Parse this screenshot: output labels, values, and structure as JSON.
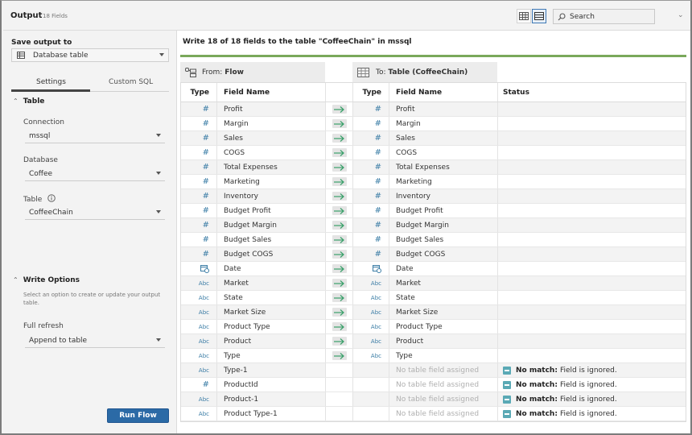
{
  "header": {
    "title": "Output",
    "field_count": "18 Fields",
    "search_placeholder": "Search",
    "view_buttons": [
      {
        "name": "grid-view",
        "active": false
      },
      {
        "name": "list-view",
        "active": true
      }
    ]
  },
  "left_panel": {
    "save_output_label": "Save output to",
    "save_output_value": "Database table",
    "tabs": [
      {
        "label": "Settings",
        "active": true
      },
      {
        "label": "Custom SQL",
        "active": false
      }
    ],
    "table_section": {
      "title": "Table",
      "connection_label": "Connection",
      "connection_value": "mssql",
      "database_label": "Database",
      "database_value": "Coffee",
      "table_label": "Table",
      "table_value": "CoffeeChain"
    },
    "write_options": {
      "title": "Write Options",
      "help": "Select an option to create or update your output table.",
      "mode_label": "Full refresh",
      "mode_value": "Append to table"
    },
    "run_button": "Run Flow"
  },
  "main": {
    "message": "Write 18 of 18 fields to the table \"CoffeeChain\" in mssql",
    "from_prefix": "From:",
    "from_name": "Flow",
    "to_prefix": "To:",
    "to_name": "Table (CoffeeChain)",
    "columns": {
      "type": "Type",
      "field_name": "Field Name",
      "status": "Status"
    },
    "rows": [
      {
        "src_type": "number",
        "src": "Profit",
        "mapped": true,
        "dst_type": "number",
        "dst": "Profit",
        "status": ""
      },
      {
        "src_type": "number",
        "src": "Margin",
        "mapped": true,
        "dst_type": "number",
        "dst": "Margin",
        "status": ""
      },
      {
        "src_type": "number",
        "src": "Sales",
        "mapped": true,
        "dst_type": "number",
        "dst": "Sales",
        "status": ""
      },
      {
        "src_type": "number",
        "src": "COGS",
        "mapped": true,
        "dst_type": "number",
        "dst": "COGS",
        "status": ""
      },
      {
        "src_type": "number",
        "src": "Total Expenses",
        "mapped": true,
        "dst_type": "number",
        "dst": "Total Expenses",
        "status": ""
      },
      {
        "src_type": "number",
        "src": "Marketing",
        "mapped": true,
        "dst_type": "number",
        "dst": "Marketing",
        "status": ""
      },
      {
        "src_type": "number",
        "src": "Inventory",
        "mapped": true,
        "dst_type": "number",
        "dst": "Inventory",
        "status": ""
      },
      {
        "src_type": "number",
        "src": "Budget Profit",
        "mapped": true,
        "dst_type": "number",
        "dst": "Budget Profit",
        "status": ""
      },
      {
        "src_type": "number",
        "src": "Budget Margin",
        "mapped": true,
        "dst_type": "number",
        "dst": "Budget Margin",
        "status": ""
      },
      {
        "src_type": "number",
        "src": "Budget Sales",
        "mapped": true,
        "dst_type": "number",
        "dst": "Budget Sales",
        "status": ""
      },
      {
        "src_type": "number",
        "src": "Budget COGS",
        "mapped": true,
        "dst_type": "number",
        "dst": "Budget COGS",
        "status": ""
      },
      {
        "src_type": "date",
        "src": "Date",
        "mapped": true,
        "dst_type": "date",
        "dst": "Date",
        "status": ""
      },
      {
        "src_type": "string",
        "src": "Market",
        "mapped": true,
        "dst_type": "string",
        "dst": "Market",
        "status": ""
      },
      {
        "src_type": "string",
        "src": "State",
        "mapped": true,
        "dst_type": "string",
        "dst": "State",
        "status": ""
      },
      {
        "src_type": "string",
        "src": "Market Size",
        "mapped": true,
        "dst_type": "string",
        "dst": "Market Size",
        "status": ""
      },
      {
        "src_type": "string",
        "src": "Product Type",
        "mapped": true,
        "dst_type": "string",
        "dst": "Product Type",
        "status": ""
      },
      {
        "src_type": "string",
        "src": "Product",
        "mapped": true,
        "dst_type": "string",
        "dst": "Product",
        "status": ""
      },
      {
        "src_type": "string",
        "src": "Type",
        "mapped": true,
        "dst_type": "string",
        "dst": "Type",
        "status": ""
      },
      {
        "src_type": "string",
        "src": "Type-1",
        "mapped": false,
        "dst_type": "",
        "dst": "No table field assigned",
        "status_bold": "No match:",
        "status": "Field is ignored."
      },
      {
        "src_type": "number",
        "src": "ProductId",
        "mapped": false,
        "dst_type": "",
        "dst": "No table field assigned",
        "status_bold": "No match:",
        "status": "Field is ignored."
      },
      {
        "src_type": "string",
        "src": "Product-1",
        "mapped": false,
        "dst_type": "",
        "dst": "No table field assigned",
        "status_bold": "No match:",
        "status": "Field is ignored."
      },
      {
        "src_type": "string",
        "src": "Product Type-1",
        "mapped": false,
        "dst_type": "",
        "dst": "No table field assigned",
        "status_bold": "No match:",
        "status": "Field is ignored."
      }
    ],
    "type_icons": {
      "number": "#",
      "string": "Abc",
      "date": "date-icon"
    },
    "colors": {
      "accent": "#2b6aa6",
      "progress": "#7aa85b",
      "type_icon": "#3a7ca5",
      "arrow": "#3aa06a",
      "status_icon": "#5aa9b5"
    }
  }
}
